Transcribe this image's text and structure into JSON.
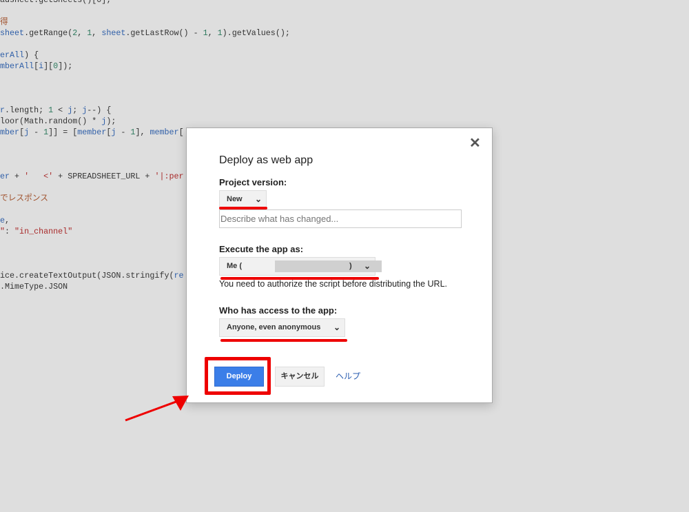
{
  "code_lines": [
    {
      "line": 0,
      "segments": [
        [
          "adsheet.getSheets()[0];",
          "txt"
        ]
      ]
    },
    {
      "line": 2,
      "segments": [
        [
          "得",
          "com"
        ]
      ]
    },
    {
      "line": 3,
      "segments": [
        [
          "sheet",
          "id"
        ],
        [
          ".getRange(",
          "txt"
        ],
        [
          "2",
          "num"
        ],
        [
          ", ",
          "txt"
        ],
        [
          "1",
          "num"
        ],
        [
          ", ",
          "txt"
        ],
        [
          "sheet",
          "id"
        ],
        [
          ".getLastRow() - ",
          "txt"
        ],
        [
          "1",
          "num"
        ],
        [
          ", ",
          "txt"
        ],
        [
          "1",
          "num"
        ],
        [
          ").getValues();",
          "txt"
        ]
      ]
    },
    {
      "line": 5,
      "segments": [
        [
          "erAll",
          "id"
        ],
        [
          ") {",
          "txt"
        ]
      ]
    },
    {
      "line": 6,
      "segments": [
        [
          "mberAll",
          "id"
        ],
        [
          "[",
          "txt"
        ],
        [
          "i",
          "id"
        ],
        [
          "][",
          "txt"
        ],
        [
          "0",
          "num"
        ],
        [
          "]);",
          "txt"
        ]
      ]
    },
    {
      "line": 10,
      "segments": [
        [
          "r",
          "id"
        ],
        [
          ".length; ",
          "txt"
        ],
        [
          "1",
          "num"
        ],
        [
          " < ",
          "txt"
        ],
        [
          "j",
          "id"
        ],
        [
          "; ",
          "txt"
        ],
        [
          "j",
          "id"
        ],
        [
          "--) {",
          "txt"
        ]
      ]
    },
    {
      "line": 11,
      "segments": [
        [
          "loor(Math.random() * ",
          "txt"
        ],
        [
          "j",
          "id"
        ],
        [
          ");",
          "txt"
        ]
      ]
    },
    {
      "line": 12,
      "segments": [
        [
          "mber",
          "id"
        ],
        [
          "[",
          "txt"
        ],
        [
          "j",
          "id"
        ],
        [
          " - ",
          "txt"
        ],
        [
          "1",
          "num"
        ],
        [
          "]] = [",
          "txt"
        ],
        [
          "member",
          "id"
        ],
        [
          "[",
          "txt"
        ],
        [
          "j",
          "id"
        ],
        [
          " - ",
          "txt"
        ],
        [
          "1",
          "num"
        ],
        [
          "], ",
          "txt"
        ],
        [
          "member",
          "id"
        ],
        [
          "[",
          "txt"
        ]
      ]
    },
    {
      "line": 16,
      "segments": [
        [
          "er",
          "id"
        ],
        [
          " + ",
          "txt"
        ],
        [
          "'   <'",
          "str"
        ],
        [
          " + SPREADSHEET_URL + ",
          "txt"
        ],
        [
          "'|:per",
          "str"
        ]
      ]
    },
    {
      "line": 18,
      "segments": [
        [
          "でレスポンス",
          "com"
        ]
      ]
    },
    {
      "line": 20,
      "segments": [
        [
          "e",
          "id"
        ],
        [
          ",",
          "txt"
        ]
      ]
    },
    {
      "line": 21,
      "segments": [
        [
          "\"",
          "str"
        ],
        [
          ": ",
          "txt"
        ],
        [
          "\"in_channel\"",
          "str"
        ]
      ]
    },
    {
      "line": 25,
      "segments": [
        [
          "ice.createTextOutput(JSON.stringify(",
          "txt"
        ],
        [
          "re",
          "id"
        ]
      ]
    },
    {
      "line": 26,
      "segments": [
        [
          ".MimeType.JSON",
          "txt"
        ]
      ]
    }
  ],
  "dialog": {
    "title": "Deploy as web app",
    "close_icon": "close-icon",
    "project_version_label": "Project version:",
    "project_version_value": "New",
    "description_placeholder": "Describe what has changed...",
    "execute_as_label": "Execute the app as:",
    "execute_as_value": "Me (",
    "execute_as_value_end": ")",
    "authorize_note": "You need to authorize the script before distributing the URL.",
    "access_label": "Who has access to the app:",
    "access_value": "Anyone, even anonymous",
    "deploy_label": "Deploy",
    "cancel_label": "キャンセル",
    "help_label": "ヘルプ"
  },
  "colors": {
    "annotation": "#e00000",
    "primary": "#3b7ee8",
    "link": "#2a5db0"
  }
}
